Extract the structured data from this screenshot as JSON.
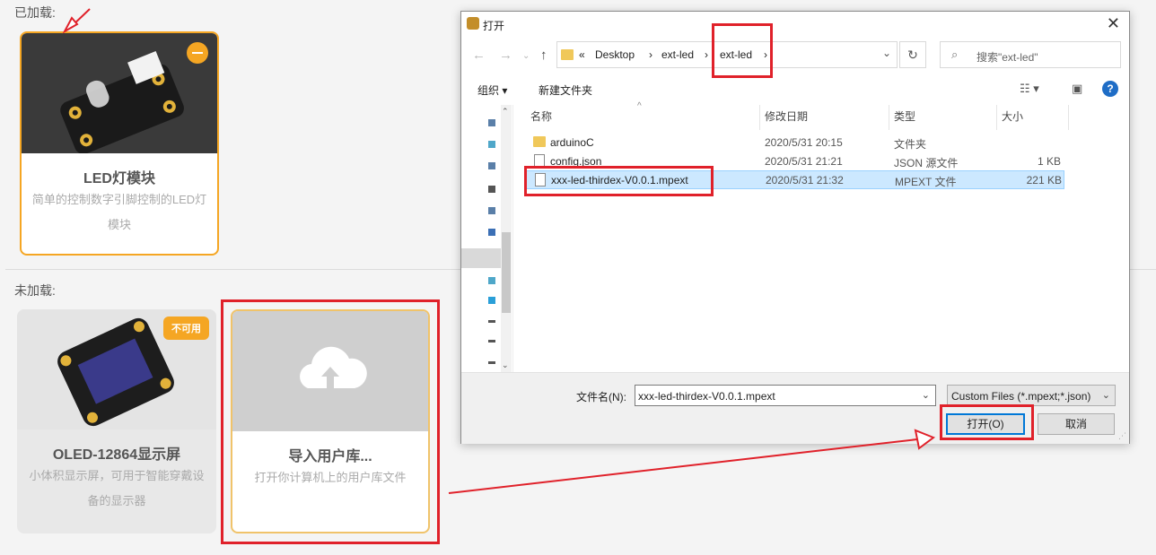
{
  "loaded": {
    "label": "已加载:",
    "card": {
      "title": "LED灯模块",
      "desc": "简单的控制数字引脚控制的LED灯模块"
    }
  },
  "unloaded": {
    "label": "未加载:",
    "oled": {
      "title": "OLED-12864显示屏",
      "desc": "小体积显示屏，可用于智能穿戴设备的显示器",
      "badge": "不可用"
    },
    "import": {
      "title": "导入用户库...",
      "desc": "打开你计算机上的用户库文件"
    }
  },
  "dialog": {
    "title": "打开",
    "breadcrumb": [
      "«",
      "Desktop",
      "›",
      "ext-led",
      "›",
      "ext-led",
      "›"
    ],
    "search_placeholder": "搜索\"ext-led\"",
    "toolbar": {
      "organize": "组织 ▾",
      "new_folder": "新建文件夹"
    },
    "columns": {
      "name": "名称",
      "date": "修改日期",
      "type": "类型",
      "size": "大小"
    },
    "files": [
      {
        "name": "arduinoC",
        "date": "2020/5/31 20:15",
        "type": "文件夹",
        "size": ""
      },
      {
        "name": "config.json",
        "date": "2020/5/31 21:21",
        "type": "JSON 源文件",
        "size": "1 KB"
      },
      {
        "name": "xxx-led-thirdex-V0.0.1.mpext",
        "date": "2020/5/31 21:32",
        "type": "MPEXT 文件",
        "size": "221 KB"
      }
    ],
    "filename_label": "文件名(N):",
    "filename_value": "xxx-led-thirdex-V0.0.1.mpext",
    "filter": "Custom Files (*.mpext;*.json)",
    "open_label": "打开(O)",
    "cancel_label": "取消"
  }
}
